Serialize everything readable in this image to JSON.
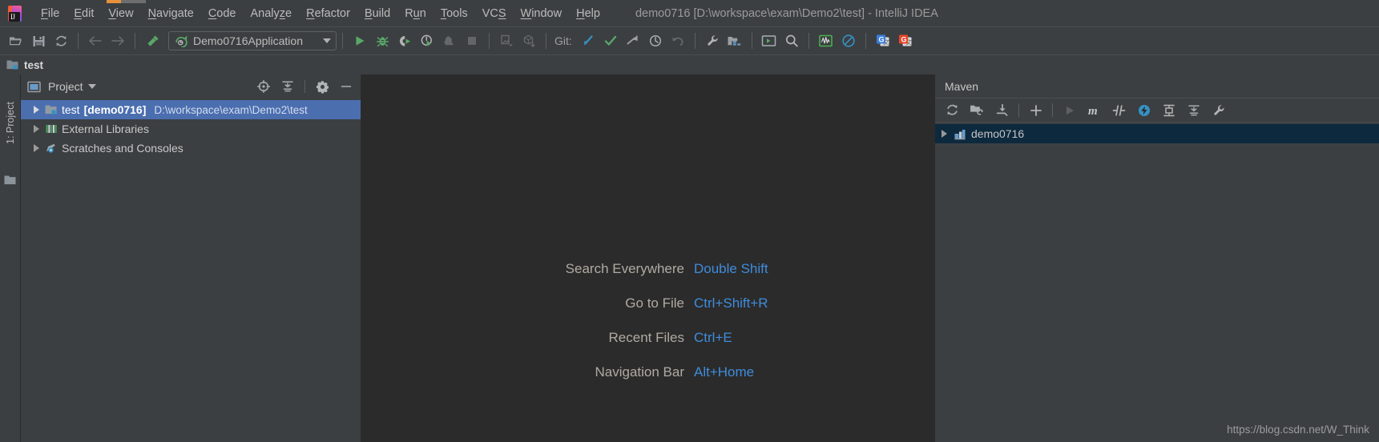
{
  "window": {
    "title": "demo0716 [D:\\workspace\\exam\\Demo2\\test] - IntelliJ IDEA",
    "logo_letter": "IJ"
  },
  "menubar": {
    "items": [
      {
        "label": "File",
        "mnemonic": "F",
        "rest": "ile"
      },
      {
        "label": "Edit",
        "mnemonic": "E",
        "rest": "dit"
      },
      {
        "label": "View",
        "mnemonic": "V",
        "rest": "iew",
        "highlighted": true
      },
      {
        "label": "Navigate",
        "mnemonic": "N",
        "rest": "avigate"
      },
      {
        "label": "Code",
        "mnemonic": "C",
        "rest": "ode"
      },
      {
        "label": "Analyze",
        "mnemonic": "z",
        "rest": "Analy|e"
      },
      {
        "label": "Refactor",
        "mnemonic": "R",
        "rest": "efactor"
      },
      {
        "label": "Build",
        "mnemonic": "B",
        "rest": "uild"
      },
      {
        "label": "Run",
        "mnemonic": "u",
        "rest": "R|n"
      },
      {
        "label": "Tools",
        "mnemonic": "T",
        "rest": "ools"
      },
      {
        "label": "VCS",
        "mnemonic": "S",
        "rest": "VC|"
      },
      {
        "label": "Window",
        "mnemonic": "W",
        "rest": "indow"
      },
      {
        "label": "Help",
        "mnemonic": "H",
        "rest": "elp"
      }
    ]
  },
  "toolbar": {
    "buttons": [
      {
        "name": "open-project-icon",
        "tooltip": "Open"
      },
      {
        "name": "save-all-icon",
        "tooltip": "Save All"
      },
      {
        "name": "synchronize-icon",
        "tooltip": "Synchronize"
      },
      {
        "name": "back-arrow-icon",
        "tooltip": "Back",
        "disabled": true
      },
      {
        "name": "forward-arrow-icon",
        "tooltip": "Forward",
        "disabled": true
      },
      {
        "name": "build-hammer-icon",
        "tooltip": "Build Project"
      }
    ],
    "run_config": {
      "name": "Demo0716Application",
      "icon": "spring-boot-icon"
    },
    "run_buttons": [
      {
        "name": "run-icon",
        "tooltip": "Run"
      },
      {
        "name": "debug-icon",
        "tooltip": "Debug"
      },
      {
        "name": "run-with-coverage-icon",
        "tooltip": "Run with Coverage"
      },
      {
        "name": "profile-icon",
        "tooltip": "Profile"
      },
      {
        "name": "attach-to-process-icon",
        "tooltip": "Attach to Process",
        "disabled": true
      },
      {
        "name": "stop-icon",
        "tooltip": "Stop",
        "disabled": true
      }
    ],
    "vcs_extra": [
      {
        "name": "update-project-icon",
        "tooltip": "Update Project",
        "disabled": true
      },
      {
        "name": "commit-icon",
        "tooltip": "Commit",
        "disabled": true
      }
    ],
    "git_label": "Git:",
    "git_buttons": [
      {
        "name": "git-update-icon",
        "tooltip": "Update Project"
      },
      {
        "name": "git-commit-check-icon",
        "tooltip": "Commit"
      },
      {
        "name": "git-push-icon",
        "tooltip": "Push"
      },
      {
        "name": "git-history-icon",
        "tooltip": "History"
      },
      {
        "name": "git-rollback-icon",
        "tooltip": "Rollback",
        "disabled": true
      }
    ],
    "right_buttons": [
      {
        "name": "settings-wrench-icon",
        "tooltip": "Settings"
      },
      {
        "name": "project-structure-icon",
        "tooltip": "Project Structure"
      },
      {
        "name": "terminal-icon",
        "tooltip": "Terminal"
      },
      {
        "name": "search-icon",
        "tooltip": "Search Everywhere"
      },
      {
        "name": "activity-monitor-icon",
        "tooltip": "Activity Monitor"
      },
      {
        "name": "no-entry-icon",
        "tooltip": "Disable Plugin"
      },
      {
        "name": "translate-blue-icon",
        "tooltip": "Translate"
      },
      {
        "name": "translate-orange-icon",
        "tooltip": "Translate Back"
      }
    ]
  },
  "navbar": {
    "crumb": "test",
    "icon": "module-folder-icon"
  },
  "left_strip": {
    "project_tab": "1: Project",
    "structure_icon": "folder-icon"
  },
  "project_panel": {
    "title": "Project",
    "view_icon": "project-view-icon",
    "header_buttons": [
      {
        "name": "scroll-from-source-icon",
        "tooltip": "Select Opened File"
      },
      {
        "name": "collapse-all-icon",
        "tooltip": "Collapse All"
      },
      {
        "name": "gear-icon",
        "tooltip": "Options"
      },
      {
        "name": "hide-icon",
        "tooltip": "Hide"
      }
    ],
    "tree": [
      {
        "name": "test",
        "bracket": "[demo0716]",
        "path": "D:\\workspace\\exam\\Demo2\\test",
        "icon": "module-folder-icon",
        "selected": true,
        "expandable": true
      },
      {
        "name": "External Libraries",
        "bracket": "",
        "path": "",
        "icon": "libraries-icon",
        "selected": false,
        "expandable": true
      },
      {
        "name": "Scratches and Consoles",
        "bracket": "",
        "path": "",
        "icon": "scratches-icon",
        "selected": false,
        "expandable": true
      }
    ]
  },
  "editor": {
    "hints": [
      {
        "label": "Search Everywhere",
        "key": "Double Shift"
      },
      {
        "label": "Go to File",
        "key": "Ctrl+Shift+R"
      },
      {
        "label": "Recent Files",
        "key": "Ctrl+E"
      },
      {
        "label": "Navigation Bar",
        "key": "Alt+Home"
      }
    ]
  },
  "maven_panel": {
    "title": "Maven",
    "toolbar_buttons": [
      {
        "name": "reimport-icon",
        "tooltip": "Reimport All Maven Projects"
      },
      {
        "name": "generate-sources-icon",
        "tooltip": "Generate Sources and Update Folders"
      },
      {
        "name": "download-sources-icon",
        "tooltip": "Download Sources and/or Documentation"
      },
      {
        "name": "add-maven-project-icon",
        "tooltip": "Add Maven Projects"
      },
      {
        "name": "run-maven-build-icon",
        "tooltip": "Run Maven Build",
        "disabled": true
      },
      {
        "name": "execute-maven-goal-icon",
        "tooltip": "Execute Maven Goal"
      },
      {
        "name": "toggle-skip-tests-icon",
        "tooltip": "Toggle Skip Tests Mode"
      },
      {
        "name": "toggle-offline-icon",
        "tooltip": "Toggle Offline Mode"
      },
      {
        "name": "show-dependencies-icon",
        "tooltip": "Show Dependencies"
      },
      {
        "name": "collapse-all-icon",
        "tooltip": "Collapse All"
      },
      {
        "name": "maven-settings-icon",
        "tooltip": "Maven Settings"
      }
    ],
    "tree": [
      {
        "name": "demo0716",
        "icon": "maven-project-icon",
        "selected": true,
        "expandable": true
      }
    ]
  },
  "watermark": "https://blog.csdn.net/W_Think",
  "colors": {
    "bg_panel": "#3c3f41",
    "bg_editor": "#2b2b2b",
    "selection_blue": "#4b6eaf",
    "maven_selection": "#0d293e",
    "accent_blue": "#3f8cdc",
    "text_primary": "#c8c8c8",
    "text_dim": "#9a9a9a",
    "green": "#499c54",
    "orange": "#e8913c"
  }
}
